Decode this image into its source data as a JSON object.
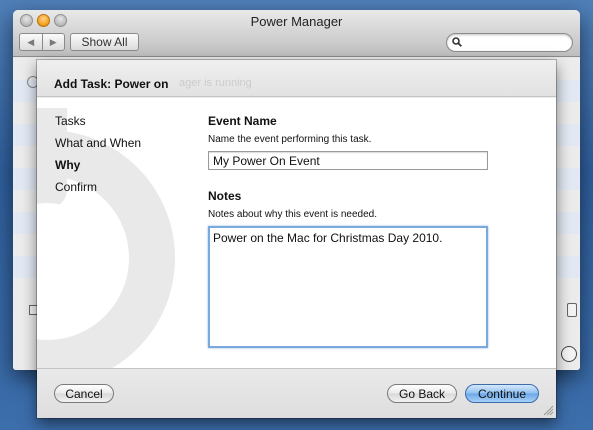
{
  "window": {
    "title": "Power Manager",
    "show_all_label": "Show All",
    "search_placeholder": ""
  },
  "sheet": {
    "title": "Add Task: Power on",
    "ghost_text": "ager is running",
    "steps": [
      {
        "label": "Tasks",
        "active": false
      },
      {
        "label": "What and When",
        "active": false
      },
      {
        "label": "Why",
        "active": true
      },
      {
        "label": "Confirm",
        "active": false
      }
    ],
    "event_name": {
      "title": "Event Name",
      "description": "Name the event performing this task.",
      "value": "My Power On Event"
    },
    "notes": {
      "title": "Notes",
      "description": "Notes about why this event is needed.",
      "value": "Power on the Mac for Christmas Day 2010."
    },
    "buttons": {
      "cancel": "Cancel",
      "go_back": "Go Back",
      "continue": "Continue"
    }
  },
  "colors": {
    "desktop": "#3c6eab",
    "default_button": "#6aa6e6",
    "focus_ring": "#7aa9dc"
  }
}
